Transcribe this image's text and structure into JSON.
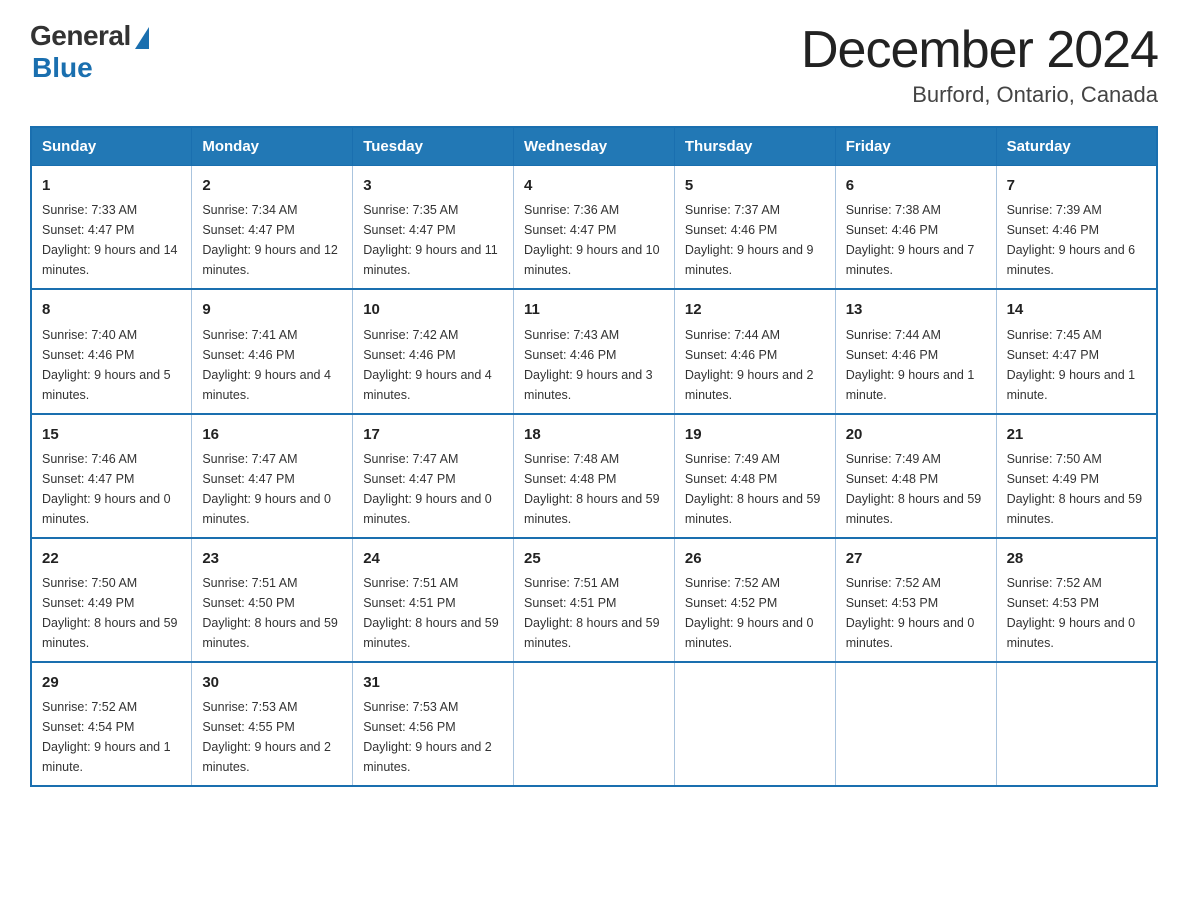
{
  "logo": {
    "text_general": "General",
    "text_blue": "Blue"
  },
  "header": {
    "month": "December 2024",
    "location": "Burford, Ontario, Canada"
  },
  "days_of_week": [
    "Sunday",
    "Monday",
    "Tuesday",
    "Wednesday",
    "Thursday",
    "Friday",
    "Saturday"
  ],
  "weeks": [
    [
      {
        "day": "1",
        "sunrise": "7:33 AM",
        "sunset": "4:47 PM",
        "daylight": "9 hours and 14 minutes."
      },
      {
        "day": "2",
        "sunrise": "7:34 AM",
        "sunset": "4:47 PM",
        "daylight": "9 hours and 12 minutes."
      },
      {
        "day": "3",
        "sunrise": "7:35 AM",
        "sunset": "4:47 PM",
        "daylight": "9 hours and 11 minutes."
      },
      {
        "day": "4",
        "sunrise": "7:36 AM",
        "sunset": "4:47 PM",
        "daylight": "9 hours and 10 minutes."
      },
      {
        "day": "5",
        "sunrise": "7:37 AM",
        "sunset": "4:46 PM",
        "daylight": "9 hours and 9 minutes."
      },
      {
        "day": "6",
        "sunrise": "7:38 AM",
        "sunset": "4:46 PM",
        "daylight": "9 hours and 7 minutes."
      },
      {
        "day": "7",
        "sunrise": "7:39 AM",
        "sunset": "4:46 PM",
        "daylight": "9 hours and 6 minutes."
      }
    ],
    [
      {
        "day": "8",
        "sunrise": "7:40 AM",
        "sunset": "4:46 PM",
        "daylight": "9 hours and 5 minutes."
      },
      {
        "day": "9",
        "sunrise": "7:41 AM",
        "sunset": "4:46 PM",
        "daylight": "9 hours and 4 minutes."
      },
      {
        "day": "10",
        "sunrise": "7:42 AM",
        "sunset": "4:46 PM",
        "daylight": "9 hours and 4 minutes."
      },
      {
        "day": "11",
        "sunrise": "7:43 AM",
        "sunset": "4:46 PM",
        "daylight": "9 hours and 3 minutes."
      },
      {
        "day": "12",
        "sunrise": "7:44 AM",
        "sunset": "4:46 PM",
        "daylight": "9 hours and 2 minutes."
      },
      {
        "day": "13",
        "sunrise": "7:44 AM",
        "sunset": "4:46 PM",
        "daylight": "9 hours and 1 minute."
      },
      {
        "day": "14",
        "sunrise": "7:45 AM",
        "sunset": "4:47 PM",
        "daylight": "9 hours and 1 minute."
      }
    ],
    [
      {
        "day": "15",
        "sunrise": "7:46 AM",
        "sunset": "4:47 PM",
        "daylight": "9 hours and 0 minutes."
      },
      {
        "day": "16",
        "sunrise": "7:47 AM",
        "sunset": "4:47 PM",
        "daylight": "9 hours and 0 minutes."
      },
      {
        "day": "17",
        "sunrise": "7:47 AM",
        "sunset": "4:47 PM",
        "daylight": "9 hours and 0 minutes."
      },
      {
        "day": "18",
        "sunrise": "7:48 AM",
        "sunset": "4:48 PM",
        "daylight": "8 hours and 59 minutes."
      },
      {
        "day": "19",
        "sunrise": "7:49 AM",
        "sunset": "4:48 PM",
        "daylight": "8 hours and 59 minutes."
      },
      {
        "day": "20",
        "sunrise": "7:49 AM",
        "sunset": "4:48 PM",
        "daylight": "8 hours and 59 minutes."
      },
      {
        "day": "21",
        "sunrise": "7:50 AM",
        "sunset": "4:49 PM",
        "daylight": "8 hours and 59 minutes."
      }
    ],
    [
      {
        "day": "22",
        "sunrise": "7:50 AM",
        "sunset": "4:49 PM",
        "daylight": "8 hours and 59 minutes."
      },
      {
        "day": "23",
        "sunrise": "7:51 AM",
        "sunset": "4:50 PM",
        "daylight": "8 hours and 59 minutes."
      },
      {
        "day": "24",
        "sunrise": "7:51 AM",
        "sunset": "4:51 PM",
        "daylight": "8 hours and 59 minutes."
      },
      {
        "day": "25",
        "sunrise": "7:51 AM",
        "sunset": "4:51 PM",
        "daylight": "8 hours and 59 minutes."
      },
      {
        "day": "26",
        "sunrise": "7:52 AM",
        "sunset": "4:52 PM",
        "daylight": "9 hours and 0 minutes."
      },
      {
        "day": "27",
        "sunrise": "7:52 AM",
        "sunset": "4:53 PM",
        "daylight": "9 hours and 0 minutes."
      },
      {
        "day": "28",
        "sunrise": "7:52 AM",
        "sunset": "4:53 PM",
        "daylight": "9 hours and 0 minutes."
      }
    ],
    [
      {
        "day": "29",
        "sunrise": "7:52 AM",
        "sunset": "4:54 PM",
        "daylight": "9 hours and 1 minute."
      },
      {
        "day": "30",
        "sunrise": "7:53 AM",
        "sunset": "4:55 PM",
        "daylight": "9 hours and 2 minutes."
      },
      {
        "day": "31",
        "sunrise": "7:53 AM",
        "sunset": "4:56 PM",
        "daylight": "9 hours and 2 minutes."
      },
      null,
      null,
      null,
      null
    ]
  ],
  "labels": {
    "sunrise": "Sunrise:",
    "sunset": "Sunset:",
    "daylight": "Daylight:"
  }
}
